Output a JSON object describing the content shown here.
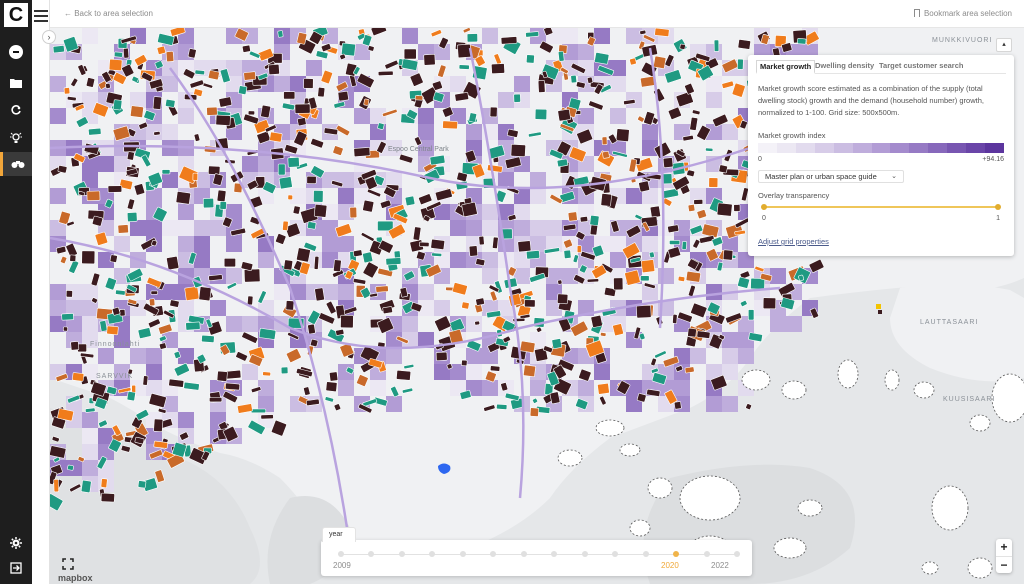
{
  "app": {
    "logo_letter": "C",
    "nav_icons": [
      "avatar-icon",
      "folder-icon",
      "refresh-icon",
      "lightbulb-icon",
      "binoculars-icon"
    ],
    "bottom_icons": [
      "gear-icon",
      "logout-icon"
    ]
  },
  "topbar": {
    "back_link": "← Back to area selection",
    "bookmark": "Bookmark area selection"
  },
  "map_labels": {
    "espoo_park": "Espoo Central Park",
    "munkkivuori": "MUNKKIVUORI",
    "lauttasaari": "LAUTTASAARI",
    "kuusisaari": "KUUSISAARI",
    "sarvvik": "SARVVIK",
    "finnoonlahti": "Finnoonlahti"
  },
  "panel": {
    "tabs": [
      "Market growth",
      "Dwelling density",
      "Target customer search"
    ],
    "active_tab": "Market growth",
    "description": "Market growth score estimated as a combination of the supply (total dwelling stock) growth and the demand (household number) growth, normalized to 1-100. Grid size: 500x500m.",
    "legend_title": "Market growth index",
    "legend_min": "0",
    "legend_max": "+94.16",
    "legend_colors": [
      "#f4f2f8",
      "#ece8f3",
      "#e2dbee",
      "#d7cce8",
      "#cbbde2",
      "#bfaddc",
      "#b29cd5",
      "#a48bcd",
      "#967ac4",
      "#8768bb",
      "#7856b1",
      "#6a45a8",
      "#5c359e"
    ],
    "select_value": "Master plan or urban space guide",
    "overlay_label": "Overlay transparency",
    "overlay_value": 1,
    "overlay_min": "0",
    "overlay_max": "1",
    "grid_link": "Adjust grid properties"
  },
  "timeline": {
    "tab_label": "year",
    "start_label": "2009",
    "selected_label": "2020",
    "end_label": "2022",
    "years": [
      2009,
      2010,
      2011,
      2012,
      2013,
      2014,
      2015,
      2016,
      2017,
      2018,
      2019,
      2020,
      2021,
      2022
    ],
    "selected_year": 2020
  },
  "zoom": {
    "in": "+",
    "out": "−"
  },
  "attribution": "mapbox",
  "colors": {
    "residential": "#3b1b1f",
    "green": "#1f9a82",
    "commercial": "#c96a2a",
    "industrial": "#f07c1c",
    "road": "#b9a3df",
    "water": "#e6e8ea",
    "land": "#f1f2f4"
  }
}
